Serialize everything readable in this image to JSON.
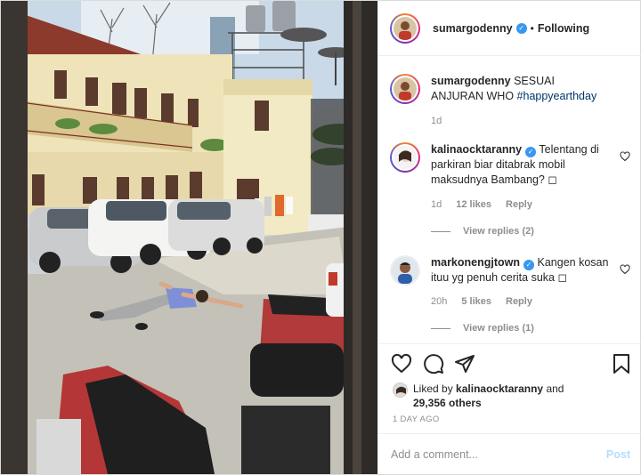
{
  "header": {
    "username": "sumargodenny",
    "separator": "•",
    "follow_label": "Following"
  },
  "caption": {
    "username": "sumargodenny",
    "text": "SESUAI ANJURAN WHO",
    "hashtag": "#happyearthday",
    "time": "1d"
  },
  "comments": [
    {
      "username": "kalinaocktaranny",
      "text": "Telentang di parkiran biar ditabrak mobil maksudnya Bambang? ◻",
      "time": "1d",
      "likes": "12 likes",
      "reply_label": "Reply",
      "view_replies": "View replies (2)"
    },
    {
      "username": "markonengjtown",
      "text": "Kangen kosan ituu yg penuh cerita suka ◻",
      "time": "20h",
      "likes": "5 likes",
      "reply_label": "Reply",
      "view_replies": "View replies (1)"
    }
  ],
  "likes": {
    "prefix": "Liked by",
    "user": "kalinaocktaranny",
    "and": "and",
    "others": "29,356 others"
  },
  "post_time": "1 DAY AGO",
  "add_comment": {
    "placeholder": "Add a comment...",
    "post_label": "Post"
  },
  "colors": {
    "accent_blue": "#3897f0",
    "muted": "#8e8e8e",
    "post_disabled": "#b2dffc",
    "hashtag": "#003569"
  },
  "icons": [
    "heart-icon",
    "comment-icon",
    "share-icon",
    "bookmark-icon",
    "verified-badge-icon"
  ]
}
